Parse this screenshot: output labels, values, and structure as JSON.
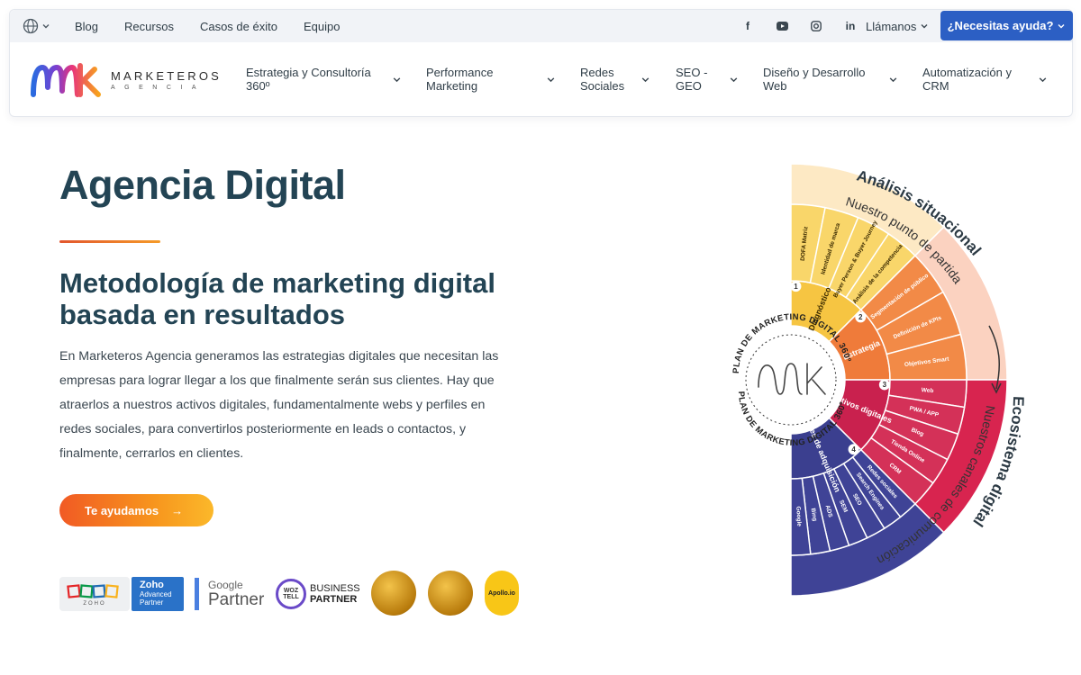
{
  "topbar": {
    "links": [
      "Blog",
      "Recursos",
      "Casos de éxito",
      "Equipo"
    ],
    "social_icons": [
      "facebook-icon",
      "youtube-icon",
      "instagram-icon",
      "linkedin-icon"
    ],
    "social_glyphs": [
      "f",
      "▶",
      "◎",
      "in"
    ],
    "call_label": "Llámanos",
    "help_label": "¿Necesitas ayuda?"
  },
  "brand": {
    "name": "MARKETEROS",
    "sub": "AGENCIA"
  },
  "nav": [
    {
      "line1": "Estrategia y Consultoría",
      "line2": "360º"
    },
    {
      "line1": "Performance",
      "line2": "Marketing"
    },
    {
      "line1": "Redes",
      "line2": "Sociales"
    },
    {
      "line1": "SEO -",
      "line2": "GEO"
    },
    {
      "line1": "Diseño y Desarrollo",
      "line2": "Web"
    },
    {
      "line1": "Automatización y",
      "line2": "CRM"
    }
  ],
  "hero": {
    "title": "Agencia Digital",
    "subtitle_line1": "Metodología de marketing digital",
    "subtitle_line2": "basada en resultados",
    "paragraph": "En Marketeros Agencia generamos las estrategias digitales que necesitan las empresas para lograr llegar a los que finalmente serán sus clientes. Hay que atraerlos a nuestros activos digitales, fundamentalmente webs y perfiles en redes sociales, para convertirlos posteriormente en leads o contactos, y finalmente, cerrarlos en clientes.",
    "cta_label": "Te ayudamos",
    "cta_arrow": "→"
  },
  "partners": {
    "zoho_word": "ZOHO",
    "zoho_badge_line1": "Zoho",
    "zoho_badge_line2": "Advanced",
    "zoho_badge_line3": "Partner",
    "google_line1": "Google",
    "google_line2": "Partner",
    "woz_line1": "WOZ",
    "woz_line2": "TELL",
    "business_line1": "BUSINESS",
    "business_line2": "PARTNER",
    "apollo": "Apollo.io"
  },
  "diagram": {
    "outer_top_title": "Análisis situacional",
    "outer_top_sub": "Nuestro punto de partida",
    "outer_bottom_title": "Ecosistema digital",
    "outer_bottom_sub": "Nuestros canales de comunicación",
    "center_ring": "PLAN DE MARKETING DIGITAL 360º",
    "phases": [
      {
        "num": "1",
        "name": "Diagnóstico",
        "items": [
          "DOFA Matriz",
          "Identidad de marca",
          "Buyer Person & Buyer Journey",
          "Análisis de la competencia"
        ]
      },
      {
        "num": "2",
        "name": "Estrategia",
        "items": [
          "Segmentación de público",
          "Definición de KPIs",
          "Objetivos Smart"
        ]
      },
      {
        "num": "3",
        "name": "Activos digitales",
        "items": [
          "Web",
          "PWA / APP",
          "Blog",
          "Tienda Online",
          "CRM"
        ]
      },
      {
        "num": "4",
        "name": "Canales de adquisición",
        "items": [
          "Redes sociales",
          "Search Engines",
          "SEO",
          "SEM",
          "ADS",
          "Bing",
          "Google"
        ]
      }
    ]
  },
  "colors": {
    "accent": "#2c5fc4",
    "heading": "#234454",
    "cta_start": "#f15a24",
    "cta_end": "#fbb82a"
  }
}
